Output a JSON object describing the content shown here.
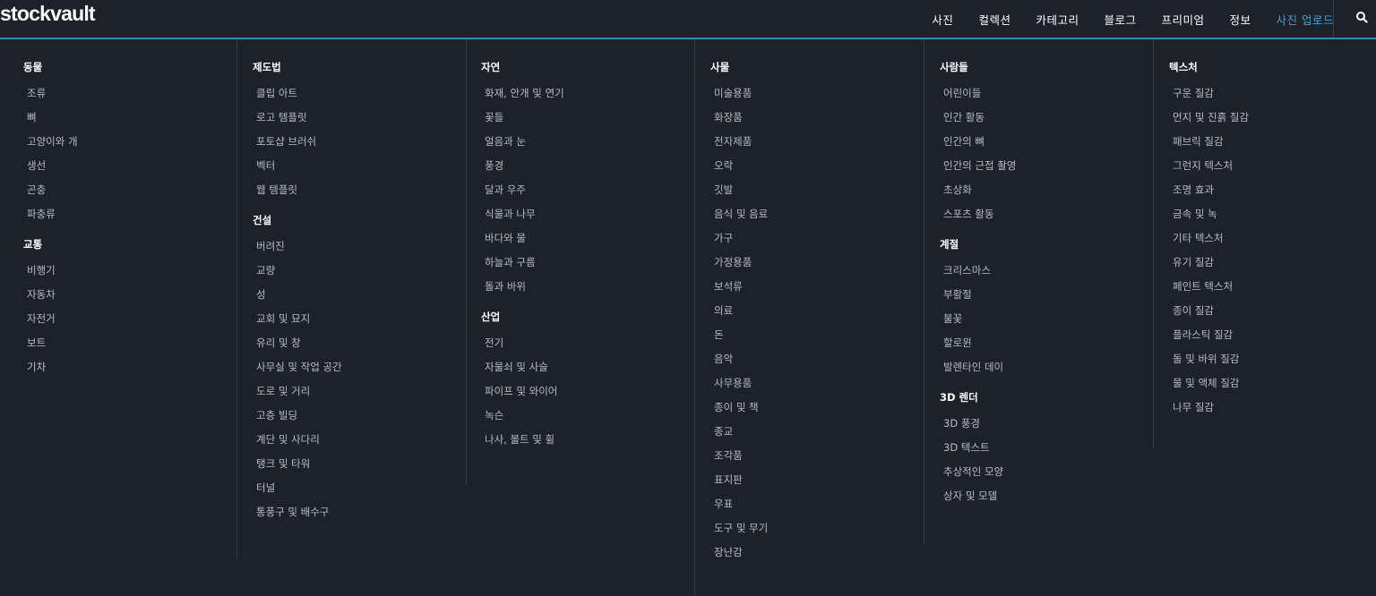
{
  "brand": {
    "logo_text": "stockvault"
  },
  "nav": {
    "items": [
      {
        "label": "사진"
      },
      {
        "label": "컬렉션"
      },
      {
        "label": "카테고리"
      },
      {
        "label": "블로그"
      },
      {
        "label": "프리미엄"
      },
      {
        "label": "정보"
      },
      {
        "label": "사진 업로드"
      }
    ],
    "search_icon": "search-icon",
    "accent_color": "#41a6d6",
    "rule_color": "#2e8fb6"
  },
  "columns": [
    {
      "groups": [
        {
          "heading": "동물",
          "items": [
            "조류",
            "뼈",
            "고양이와 개",
            "생선",
            "곤충",
            "파충류"
          ]
        },
        {
          "heading": "교통",
          "items": [
            "비행기",
            "자동차",
            "자전거",
            "보트",
            "기차"
          ]
        }
      ]
    },
    {
      "groups": [
        {
          "heading": "제도법",
          "items": [
            "클립 아트",
            "로고 템플릿",
            "포토샵 브러쉬",
            "벡터",
            "웹 템플릿"
          ]
        },
        {
          "heading": "건설",
          "items": [
            "버려진",
            "교량",
            "성",
            "교회 및 묘지",
            "유리 및 창",
            "사무실 및 작업 공간",
            "도로 및 거리",
            "고층 빌딩",
            "계단 및 사다리",
            "탱크 및 타워",
            "터널",
            "통풍구 및 배수구"
          ]
        }
      ]
    },
    {
      "groups": [
        {
          "heading": "자연",
          "items": [
            "화재, 안개 및 연기",
            "꽃들",
            "얼음과 눈",
            "풍경",
            "달과 우주",
            "식물과 나무",
            "바다와 물",
            "하늘과 구름",
            "돌과 바위"
          ]
        },
        {
          "heading": "산업",
          "items": [
            "전기",
            "자물쇠 및 사슬",
            "파이프 및 와이어",
            "녹슨",
            "나사, 볼트 및 휠"
          ]
        }
      ]
    },
    {
      "groups": [
        {
          "heading": "사물",
          "items": [
            "미술용품",
            "화장품",
            "전자제품",
            "오락",
            "깃발",
            "음식 및 음료",
            "가구",
            "가정용품",
            "보석류",
            "의료",
            "돈",
            "음악",
            "사무용품",
            "종이 및 책",
            "종교",
            "조각품",
            "표지판",
            "우표",
            "도구 및 무기",
            "장난감"
          ]
        }
      ]
    },
    {
      "groups": [
        {
          "heading": "사람들",
          "items": [
            "어린이들",
            "인간 활동",
            "인간의 뼈",
            "인간의 근접 촬영",
            "초상화",
            "스포츠 활동"
          ]
        },
        {
          "heading": "계절",
          "items": [
            "크리스마스",
            "부활절",
            "불꽃",
            "할로윈",
            "발렌타인 데이"
          ]
        },
        {
          "heading": "3D 렌더",
          "items": [
            "3D 풍경",
            "3D 텍스트",
            "추상적인 모양",
            "상자 및 모델"
          ]
        }
      ]
    },
    {
      "groups": [
        {
          "heading": "텍스처",
          "items": [
            "구운 질감",
            "먼지 및 진흙 질감",
            "패브릭 질감",
            "그런지 텍스처",
            "조명 효과",
            "금속 및 녹",
            "기타 텍스처",
            "유기 질감",
            "페인트 텍스처",
            "종이 질감",
            "플라스틱 질감",
            "돌 및 바위 질감",
            "물 및 액체 질감",
            "나무 질감"
          ]
        }
      ]
    }
  ]
}
